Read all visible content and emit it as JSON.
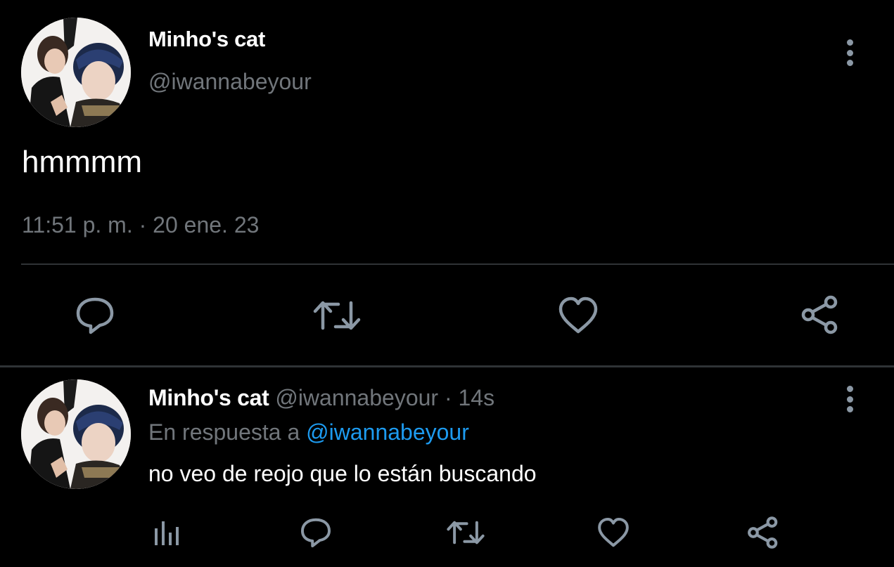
{
  "main_tweet": {
    "display_name": "Minho's cat",
    "handle": "@iwannabeyour",
    "text": "hmmmm",
    "timestamp": "11:51 p. m. · 20 ene. 23",
    "avatar": "profile-photo",
    "actions": [
      "reply-icon",
      "retweet-icon",
      "like-icon",
      "share-icon"
    ]
  },
  "reply_tweet": {
    "display_name": "Minho's cat",
    "handle": "@iwannabeyour",
    "separator": " · ",
    "time": "14s",
    "reply_prefix": "En respuesta a ",
    "reply_to": "@iwannabeyour",
    "text": "no veo de reojo que lo están buscando",
    "avatar": "profile-photo",
    "actions": [
      "analytics-icon",
      "reply-icon",
      "retweet-icon",
      "like-icon",
      "share-icon"
    ]
  },
  "colors": {
    "background": "#000000",
    "primary_text": "#ffffff",
    "secondary_text": "#71767b",
    "icon": "#8b98a5",
    "divider": "#2f3336",
    "link": "#1d9bf0"
  }
}
